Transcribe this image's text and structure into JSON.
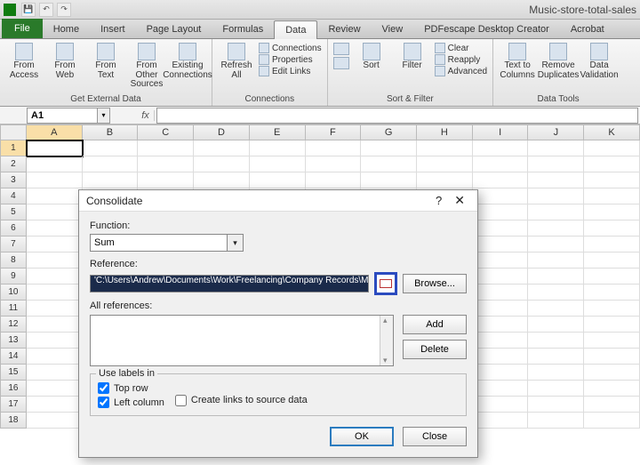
{
  "window": {
    "title": "Music-store-total-sales"
  },
  "qat": {
    "save": "💾",
    "undo": "↶",
    "redo": "↷"
  },
  "tabs": {
    "file": "File",
    "items": [
      "Home",
      "Insert",
      "Page Layout",
      "Formulas",
      "Data",
      "Review",
      "View",
      "PDFescape Desktop Creator",
      "Acrobat"
    ],
    "active": "Data"
  },
  "ribbon": {
    "get_external": {
      "label": "Get External Data",
      "from_access": "From\nAccess",
      "from_web": "From\nWeb",
      "from_text": "From\nText",
      "from_other": "From Other\nSources",
      "existing": "Existing\nConnections"
    },
    "connections": {
      "label": "Connections",
      "refresh": "Refresh\nAll",
      "conn": "Connections",
      "props": "Properties",
      "edit": "Edit Links"
    },
    "sortfilter": {
      "label": "Sort & Filter",
      "az": "A↓Z",
      "za": "Z↓A",
      "sort": "Sort",
      "filter": "Filter",
      "clear": "Clear",
      "reapply": "Reapply",
      "advanced": "Advanced"
    },
    "datatools": {
      "label": "Data Tools",
      "t2c": "Text to\nColumns",
      "remdup": "Remove\nDuplicates",
      "valid": "Data\nValidation"
    }
  },
  "namebox": "A1",
  "columns": [
    "A",
    "B",
    "C",
    "D",
    "E",
    "F",
    "G",
    "H",
    "I",
    "J",
    "K"
  ],
  "rows": [
    1,
    2,
    3,
    4,
    5,
    6,
    7,
    8,
    9,
    10,
    11,
    12,
    13,
    14,
    15,
    16,
    17,
    18
  ],
  "dialog": {
    "title": "Consolidate",
    "help": "?",
    "close": "✕",
    "function_label": "Function:",
    "function_value": "Sum",
    "reference_label": "Reference:",
    "reference_value": "'C:\\Users\\Andrew\\Documents\\Work\\Freelancing\\Company Records\\M",
    "browse": "Browse...",
    "allrefs_label": "All references:",
    "add": "Add",
    "delete": "Delete",
    "uselabels": "Use labels in",
    "toprow": "Top row",
    "leftcol": "Left column",
    "createlinks": "Create links to source data",
    "ok": "OK",
    "closebtn": "Close"
  }
}
